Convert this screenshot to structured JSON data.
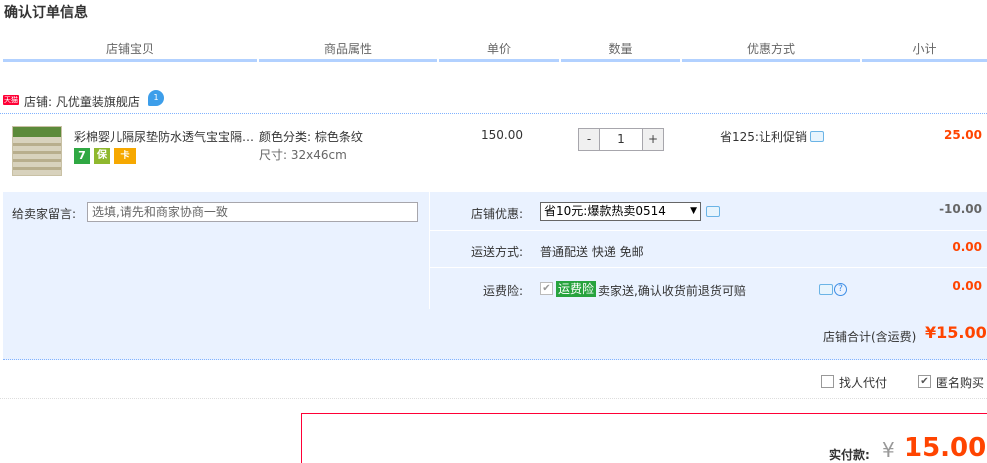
{
  "page_title": "确认订单信息",
  "columns": [
    "店铺宝贝",
    "商品属性",
    "单价",
    "数量",
    "优惠方式",
    "小计"
  ],
  "shop": {
    "badge": "天猫",
    "name": "店铺: 凡优童装旗舰店",
    "wangwang_badge": "1"
  },
  "item": {
    "title": "彩棉婴儿隔尿垫防水透气宝宝隔尿垫",
    "service_icons": [
      "7",
      "保",
      "卡"
    ],
    "attr_color": "颜色分类: 棕色条纹",
    "attr_size": "尺寸: 32x46cm",
    "price": "150.00",
    "qty": {
      "minus": "-",
      "value": "1",
      "plus": "+"
    },
    "promo": "省125:让利促销",
    "subtotal": "25.00"
  },
  "memo": {
    "label": "给卖家留言:",
    "placeholder": "选填,请先和商家协商一致"
  },
  "shop_discount": {
    "label": "店铺优惠:",
    "selected": "省10元:爆款热卖0514",
    "value": "-10.00"
  },
  "shipping": {
    "label": "运送方式:",
    "text": "普通配送 快递 免邮",
    "value": "0.00"
  },
  "insurance": {
    "label": "运费险:",
    "badge": "运费险",
    "text": "卖家送,确认收货前退货可赔",
    "value": "0.00"
  },
  "shop_total": {
    "label": "店铺合计(含运费)",
    "value": "¥15.00"
  },
  "agent_pay": "找人代付",
  "anonymous": "匿名购买",
  "pay": {
    "label": "实付款:",
    "currency": "¥",
    "value": "15.00"
  },
  "colors": {
    "accent": "#ff4400",
    "tmall": "#ff0036",
    "panel": "#eaf2ff",
    "header_line": "#b2d1ff"
  }
}
